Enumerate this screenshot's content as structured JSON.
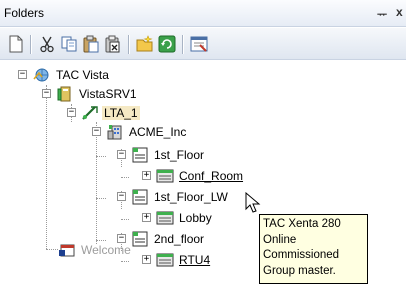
{
  "panel": {
    "title": "Folders",
    "pin_glyph": "ᅲ",
    "close_glyph": "x"
  },
  "toolbar": {
    "buttons": [
      {
        "name": "new-icon"
      },
      {
        "name": "cut-icon"
      },
      {
        "name": "copy-icon"
      },
      {
        "name": "paste-icon"
      },
      {
        "name": "delete-icon"
      },
      {
        "name": "new-folder-icon"
      },
      {
        "name": "refresh-icon"
      },
      {
        "name": "properties-icon"
      }
    ]
  },
  "tree": {
    "root": "TAC Vista",
    "server": "VistaSRV1",
    "lta": "LTA_1",
    "company": "ACME_Inc",
    "floor1": "1st_Floor",
    "conf_room": "Conf_Room",
    "floor1_lw": "1st_Floor_LW",
    "lobby": "Lobby",
    "floor2": "2nd_floor",
    "rtu4": "RTU4",
    "welcome": "Welcome"
  },
  "tooltip": {
    "line1": "TAC Xenta 280",
    "line2": "Online",
    "line3": "Commissioned",
    "line4": "Group master."
  },
  "colors": {
    "selection": "#f5e9c4",
    "tooltip_bg": "#ffffe1",
    "panel_header": "#e6ecf5"
  }
}
